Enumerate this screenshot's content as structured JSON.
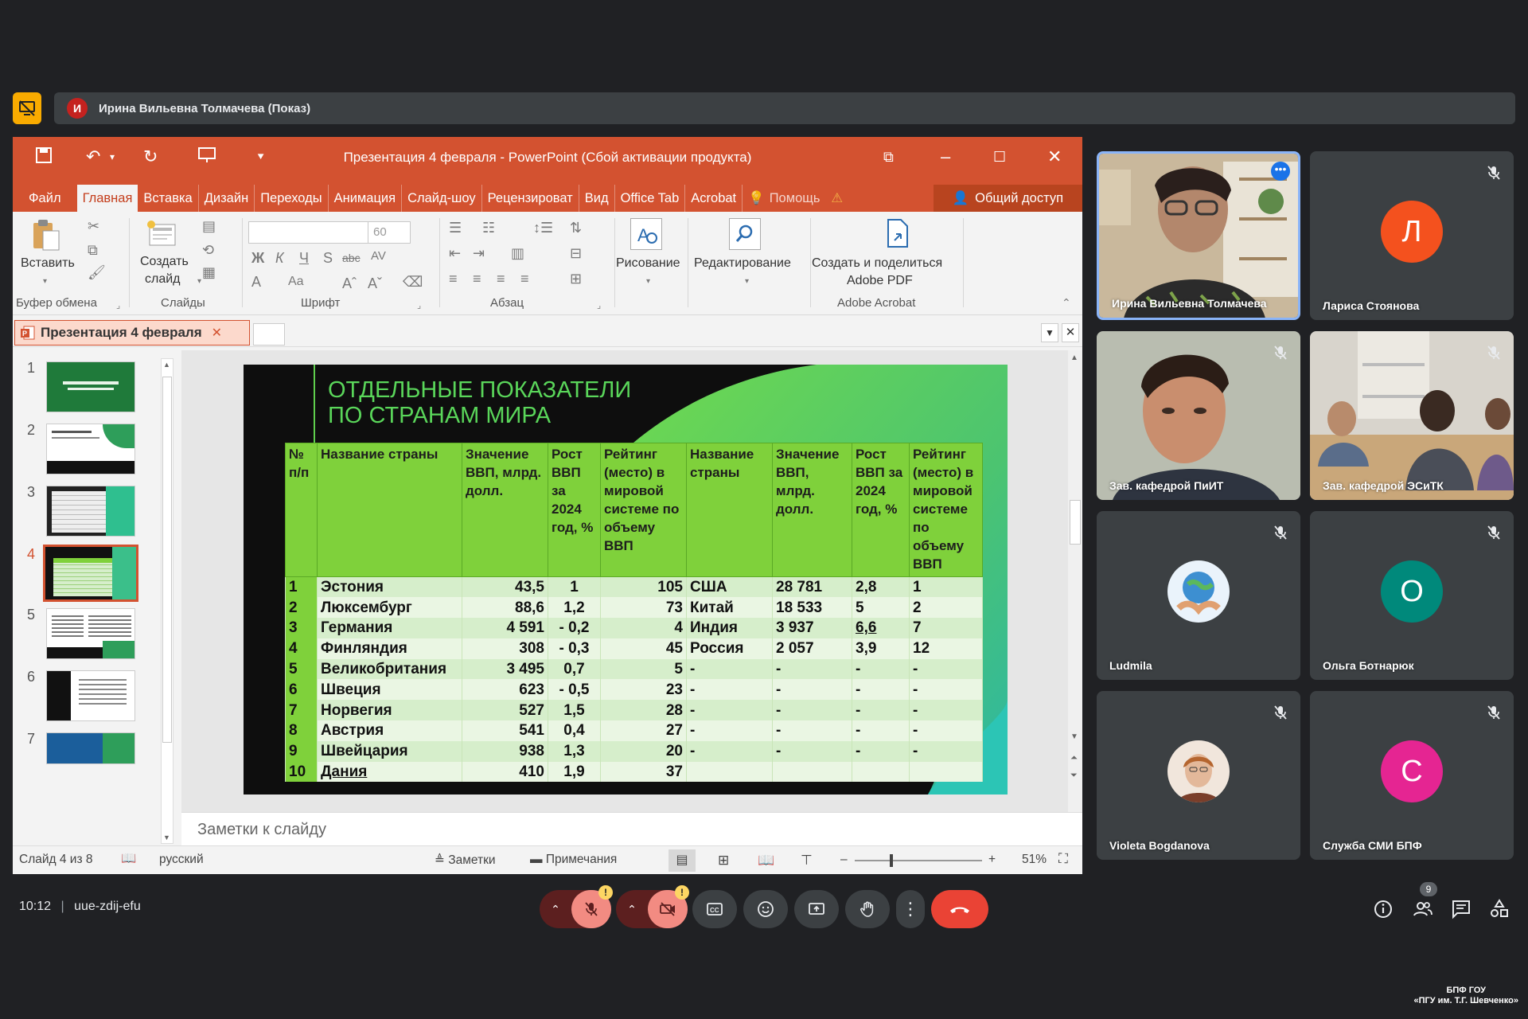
{
  "meeting": {
    "presenter_initial": "И",
    "presenter_label": "Ирина Вильевна Толмачева (Показ)",
    "time": "10:12",
    "separator": "|",
    "code": "uue-zdij-efu",
    "participants_count": "9"
  },
  "ppt": {
    "window_title": "Презентация 4 февраля - PowerPoint (Сбой активации продукта)",
    "tabs": [
      "Файл",
      "Главная",
      "Вставка",
      "Дизайн",
      "Переходы",
      "Анимация",
      "Слайд-шоу",
      "Рецензироват",
      "Вид",
      "Office Tab",
      "Acrobat",
      "Помощь"
    ],
    "share": "Общий доступ",
    "ribbon": {
      "paste": "Вставить",
      "new_slide_1": "Создать",
      "new_slide_2": "слайд",
      "font_size": "60",
      "drawing": "Рисование",
      "editing": "Редактирование",
      "create_pdf_1": "Создать и поделиться",
      "create_pdf_2": "Adobe PDF",
      "groups": [
        "Буфер обмена",
        "Слайды",
        "Шрифт",
        "Абзац",
        "Adobe Acrobat"
      ]
    },
    "doc_tab": "Презентация 4 февраля",
    "slide_numbers": [
      "1",
      "2",
      "3",
      "4",
      "5",
      "6",
      "7"
    ],
    "notes_placeholder": "Заметки к слайду",
    "status": {
      "slide_of": "Слайд 4 из 8",
      "language": "русский",
      "notes": "Заметки",
      "comments": "Примечания",
      "zoom": "51%"
    }
  },
  "slide": {
    "title_line1": "ОТДЕЛЬНЫЕ ПОКАЗАТЕЛИ",
    "title_line2": "ПО СТРАНАМ МИРА",
    "headers": [
      "№ п/п",
      "Название страны",
      "Значение ВВП, млрд. долл.",
      "Рост ВВП за 2024 год, %",
      "Рейтинг (место) в мировой системе по объему ВВП",
      "Название страны",
      "Значение ВВП, млрд. долл.",
      "Рост ВВП за 2024 год, %",
      "Рейтинг (место) в мировой системе по объему ВВП"
    ],
    "rows": [
      [
        "1",
        "Эстония",
        "43,5",
        "1",
        "105",
        "США",
        "28 781",
        "2,8",
        "1"
      ],
      [
        "2",
        "Люксембург",
        "88,6",
        "1,2",
        "73",
        "Китай",
        "18 533",
        "5",
        "2"
      ],
      [
        "3",
        "Германия",
        "4 591",
        "- 0,2",
        "4",
        "Индия",
        "3 937",
        "6,6",
        "7"
      ],
      [
        "4",
        "Финляндия",
        "308",
        "- 0,3",
        "45",
        "Россия",
        "2 057",
        "3,9",
        "12"
      ],
      [
        "5",
        "Великобритания",
        "3 495",
        "0,7",
        "5",
        "-",
        "-",
        "-",
        "-"
      ],
      [
        "6",
        "Швеция",
        "623",
        "- 0,5",
        "23",
        "-",
        "-",
        "-",
        "-"
      ],
      [
        "7",
        "Норвегия",
        "527",
        "1,5",
        "28",
        "-",
        "-",
        "-",
        "-"
      ],
      [
        "8",
        "Австрия",
        "541",
        "0,4",
        "27",
        "-",
        "-",
        "-",
        "-"
      ],
      [
        "9",
        "Швейцария",
        "938",
        "1,3",
        "20",
        "-",
        "-",
        "-",
        "-"
      ],
      [
        "10",
        "Дания",
        "410",
        "1,9",
        "37",
        "",
        "",
        "",
        ""
      ]
    ]
  },
  "participants": [
    {
      "name": "Ирина Вильевна Толмачева"
    },
    {
      "name": "Лариса Стоянова",
      "initial": "Л",
      "color": "#f4511e"
    },
    {
      "name": "Зав. кафедрой ПиИТ"
    },
    {
      "name": "Зав. кафедрой ЭСиТК"
    },
    {
      "name": "Ludmila"
    },
    {
      "name": "Ольга Ботнарюк",
      "initial": "О",
      "color": "#00897b"
    },
    {
      "name": "Violeta Bogdanova"
    },
    {
      "name": "Служба СМИ БПФ",
      "initial": "С",
      "color": "#e52592"
    }
  ],
  "watermark": {
    "line1": "БПФ ГОУ",
    "line2": "«ПГУ им. Т.Г. Шевченко»"
  }
}
